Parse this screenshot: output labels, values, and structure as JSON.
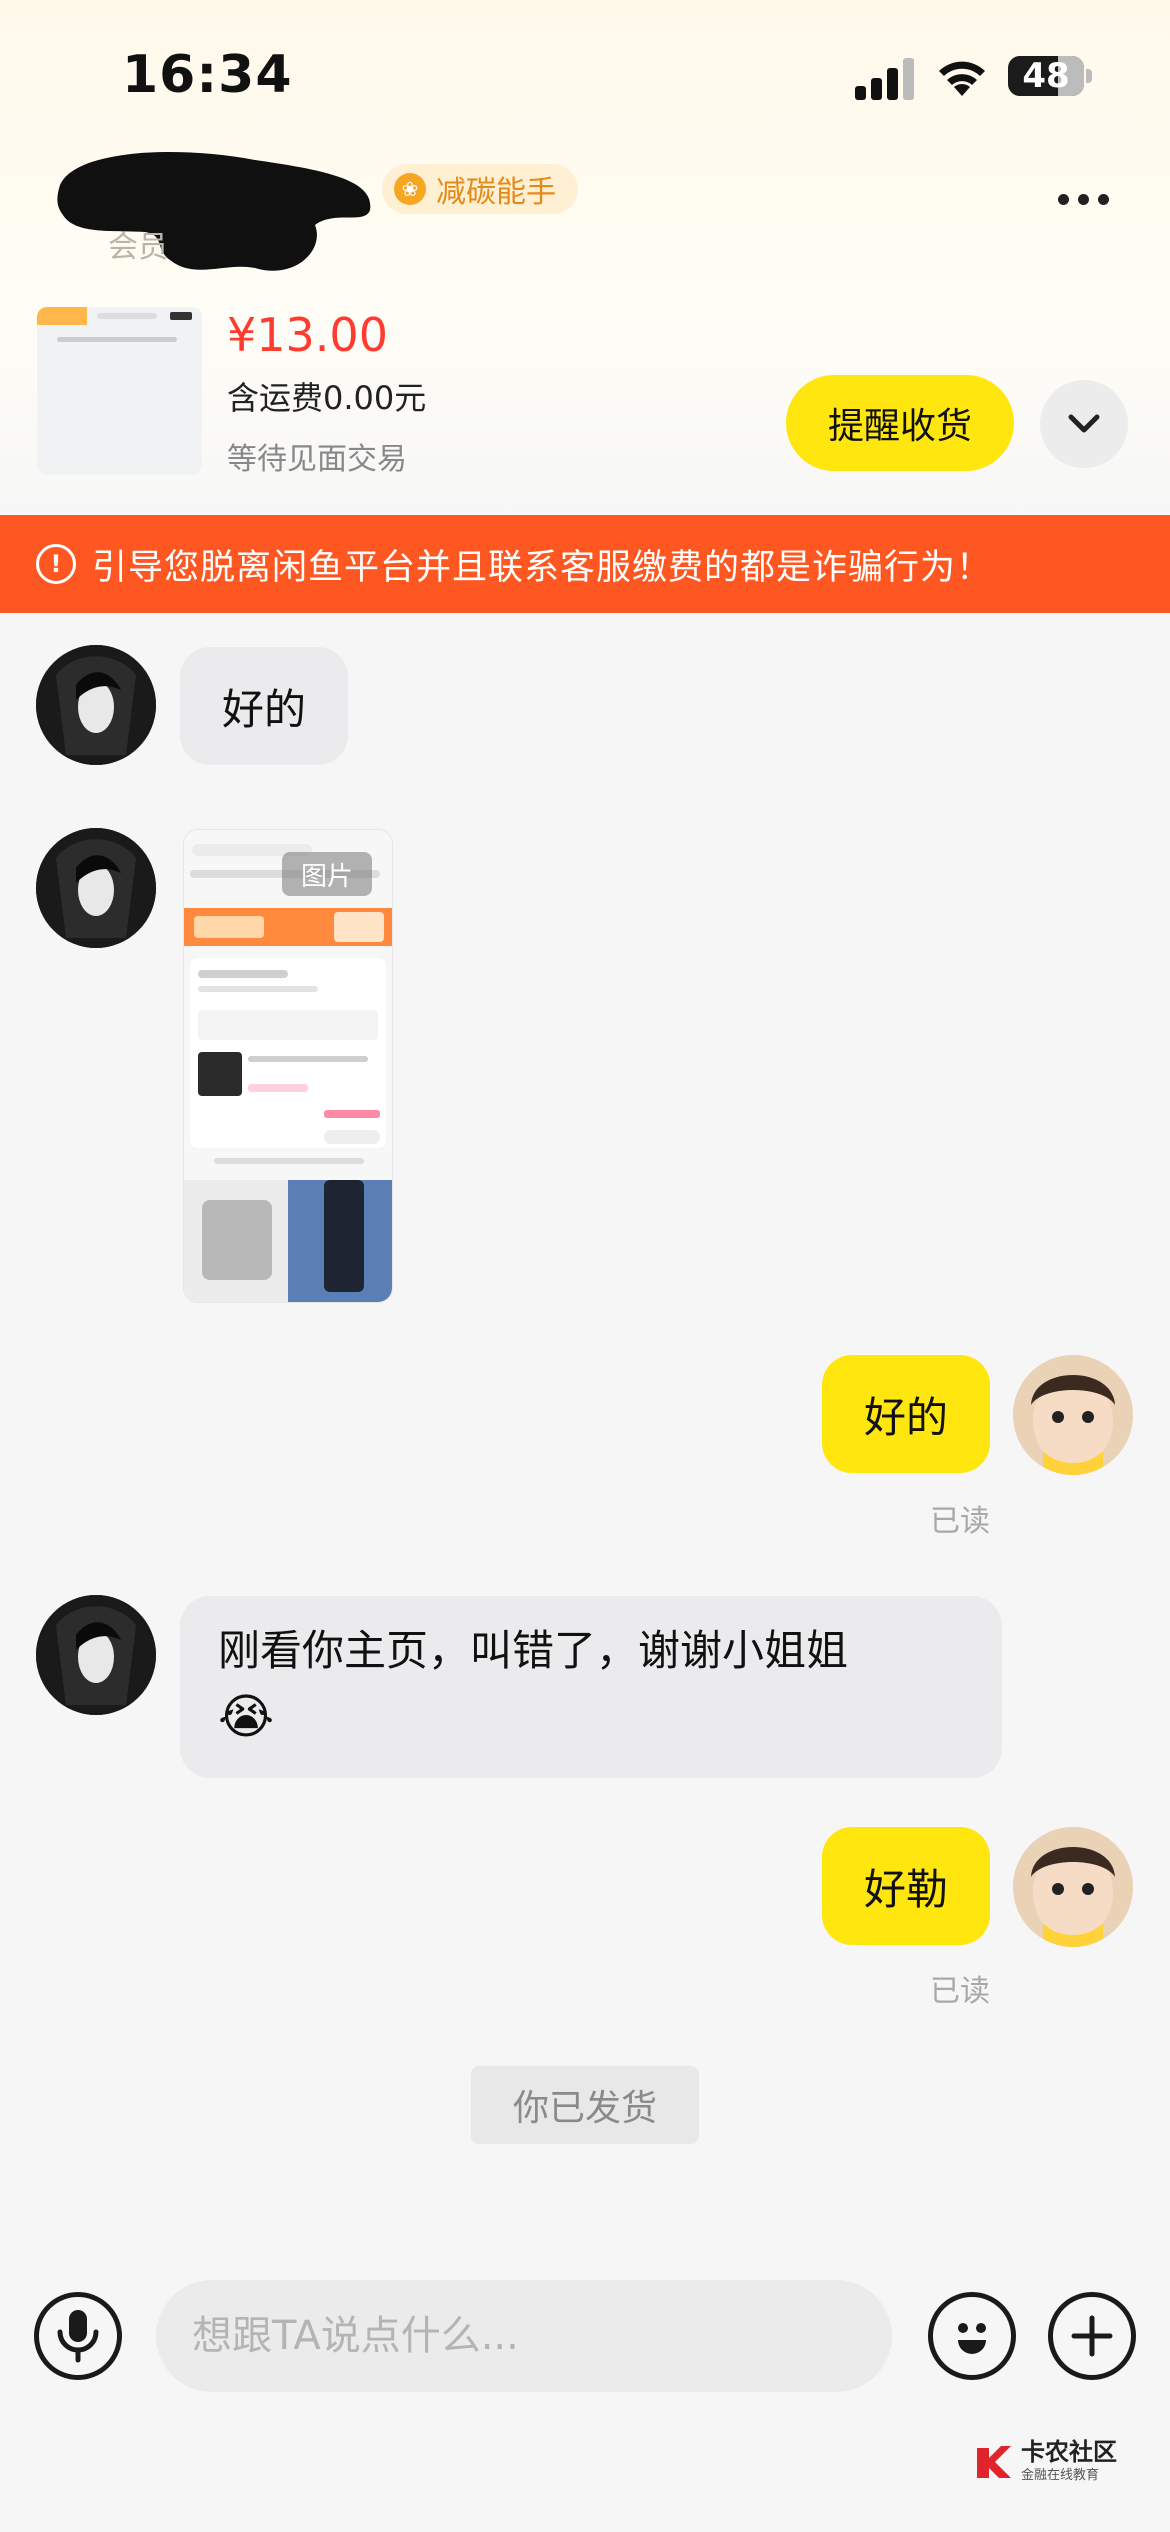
{
  "status_bar": {
    "time": "16:34",
    "battery": "48"
  },
  "header": {
    "user_sub_label": "会员",
    "badge_label": "减碳能手"
  },
  "order": {
    "price": "¥13.00",
    "shipping": "含运费0.00元",
    "status": "等待见面交易",
    "remind_button": "提醒收货"
  },
  "warning": {
    "text": "引导您脱离闲鱼平台并且联系客服缴费的都是诈骗行为！"
  },
  "messages": {
    "m1": {
      "text": "好的"
    },
    "m2": {
      "image_tag": "图片"
    },
    "m3": {
      "text": "好的",
      "status": "已读"
    },
    "m4": {
      "text": "刚看你主页，叫错了，谢谢小姐姐",
      "emoji": "😭"
    },
    "m5": {
      "text": "好勒",
      "status": "已读"
    },
    "system": "你已发货"
  },
  "input": {
    "placeholder": "想跟TA说点什么..."
  },
  "watermark": {
    "title": "卡农社区",
    "subtitle": "金融在线教育"
  },
  "colors": {
    "accent_yellow": "#ffe60f",
    "warning_orange": "#ff5722",
    "price_red": "#ff3b30"
  }
}
